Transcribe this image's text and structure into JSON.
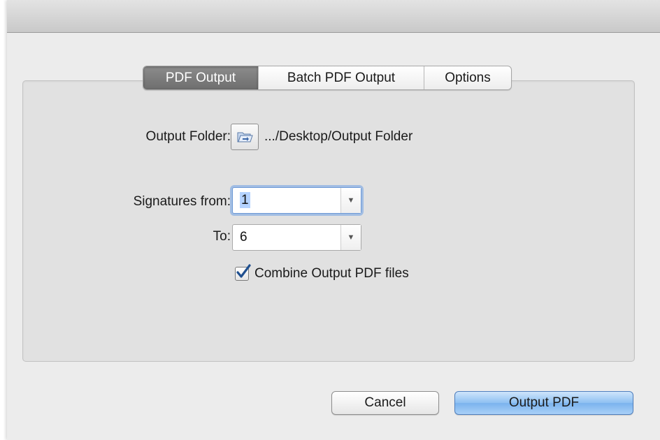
{
  "tabs": [
    {
      "label": "PDF Output",
      "active": true
    },
    {
      "label": "Batch PDF Output",
      "active": false
    },
    {
      "label": "Options",
      "active": false
    }
  ],
  "output_folder": {
    "label": "Output Folder:",
    "icon": "folder-open-icon",
    "path": ".../Desktop/Output Folder"
  },
  "signatures_from": {
    "label": "Signatures from:",
    "value": "1"
  },
  "signatures_to": {
    "label": "To:",
    "value": "6"
  },
  "combine": {
    "label": "Combine Output PDF files",
    "checked": true
  },
  "buttons": {
    "cancel": "Cancel",
    "output": "Output PDF"
  },
  "colors": {
    "accent": "#7bb3ee",
    "focus_ring": "#6e9ad6",
    "checkmark": "#1f4f8f"
  }
}
